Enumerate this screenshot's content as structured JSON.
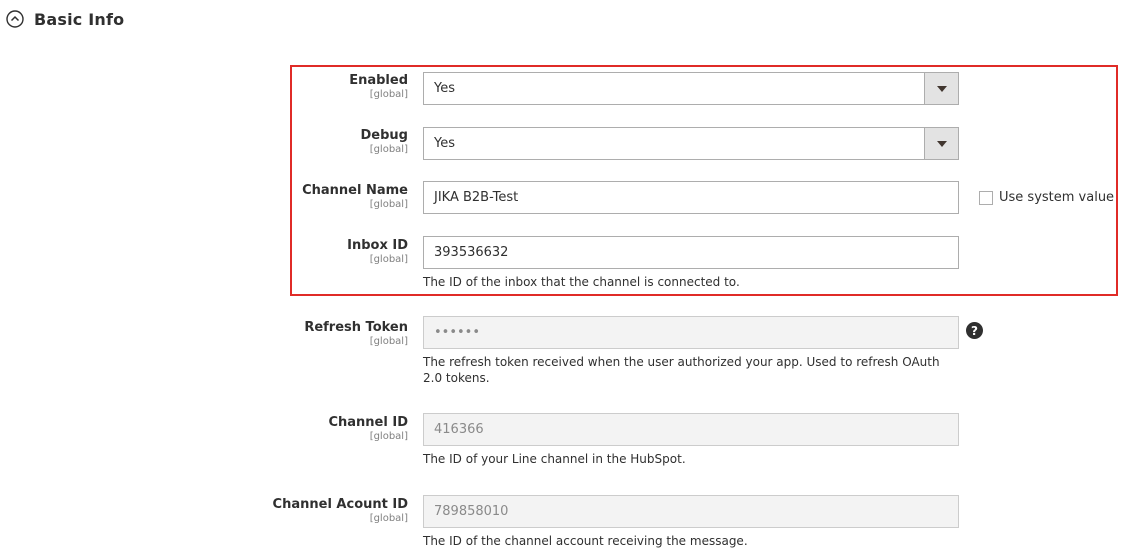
{
  "section": {
    "title": "Basic Info",
    "icon": "chevron-up-circle-icon"
  },
  "fields": {
    "enabled": {
      "label": "Enabled",
      "scope": "[global]",
      "value": "Yes"
    },
    "debug": {
      "label": "Debug",
      "scope": "[global]",
      "value": "Yes"
    },
    "channel_name": {
      "label": "Channel Name",
      "scope": "[global]",
      "value": "JIKA B2B-Test",
      "use_system_value": "Use system value"
    },
    "inbox_id": {
      "label": "Inbox ID",
      "scope": "[global]",
      "value": "393536632",
      "note": "The ID of the inbox that the channel is connected to."
    },
    "refresh_token": {
      "label": "Refresh Token",
      "scope": "[global]",
      "value": "••••••",
      "note": "The refresh token received when the user authorized your app. Used to refresh OAuth 2.0 tokens.",
      "help": "?"
    },
    "channel_id": {
      "label": "Channel ID",
      "scope": "[global]",
      "value": "416366",
      "note": "The ID of your Line channel in the HubSpot."
    },
    "channel_account_id": {
      "label": "Channel Acount ID",
      "scope": "[global]",
      "value": "789858010",
      "note": "The ID of the channel account receiving the message."
    }
  },
  "colors": {
    "highlight": "#e02b27",
    "disabled_bg": "#f3f3f3"
  }
}
